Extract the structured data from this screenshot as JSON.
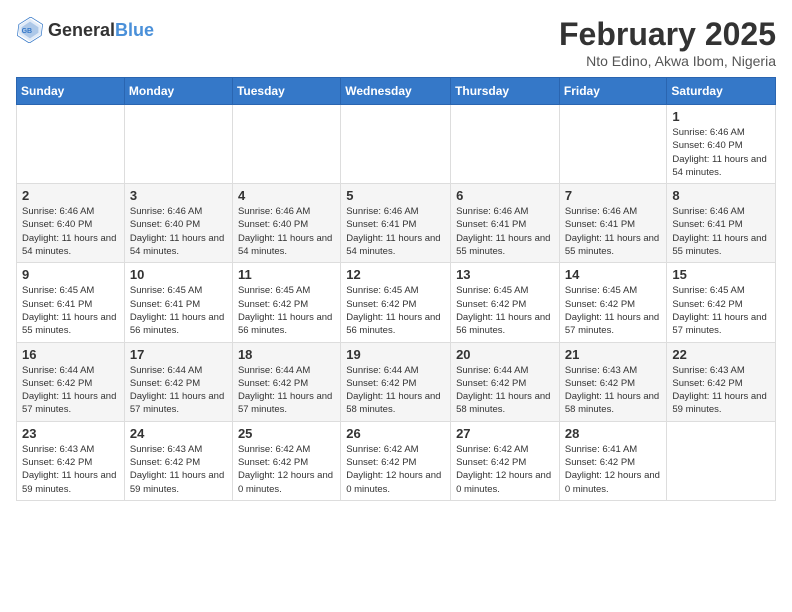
{
  "logo": {
    "text_general": "General",
    "text_blue": "Blue"
  },
  "title": "February 2025",
  "subtitle": "Nto Edino, Akwa Ibom, Nigeria",
  "days_of_week": [
    "Sunday",
    "Monday",
    "Tuesday",
    "Wednesday",
    "Thursday",
    "Friday",
    "Saturday"
  ],
  "weeks": [
    [
      {
        "day": "",
        "info": ""
      },
      {
        "day": "",
        "info": ""
      },
      {
        "day": "",
        "info": ""
      },
      {
        "day": "",
        "info": ""
      },
      {
        "day": "",
        "info": ""
      },
      {
        "day": "",
        "info": ""
      },
      {
        "day": "1",
        "info": "Sunrise: 6:46 AM\nSunset: 6:40 PM\nDaylight: 11 hours and 54 minutes."
      }
    ],
    [
      {
        "day": "2",
        "info": "Sunrise: 6:46 AM\nSunset: 6:40 PM\nDaylight: 11 hours and 54 minutes."
      },
      {
        "day": "3",
        "info": "Sunrise: 6:46 AM\nSunset: 6:40 PM\nDaylight: 11 hours and 54 minutes."
      },
      {
        "day": "4",
        "info": "Sunrise: 6:46 AM\nSunset: 6:40 PM\nDaylight: 11 hours and 54 minutes."
      },
      {
        "day": "5",
        "info": "Sunrise: 6:46 AM\nSunset: 6:41 PM\nDaylight: 11 hours and 54 minutes."
      },
      {
        "day": "6",
        "info": "Sunrise: 6:46 AM\nSunset: 6:41 PM\nDaylight: 11 hours and 55 minutes."
      },
      {
        "day": "7",
        "info": "Sunrise: 6:46 AM\nSunset: 6:41 PM\nDaylight: 11 hours and 55 minutes."
      },
      {
        "day": "8",
        "info": "Sunrise: 6:46 AM\nSunset: 6:41 PM\nDaylight: 11 hours and 55 minutes."
      }
    ],
    [
      {
        "day": "9",
        "info": "Sunrise: 6:45 AM\nSunset: 6:41 PM\nDaylight: 11 hours and 55 minutes."
      },
      {
        "day": "10",
        "info": "Sunrise: 6:45 AM\nSunset: 6:41 PM\nDaylight: 11 hours and 56 minutes."
      },
      {
        "day": "11",
        "info": "Sunrise: 6:45 AM\nSunset: 6:42 PM\nDaylight: 11 hours and 56 minutes."
      },
      {
        "day": "12",
        "info": "Sunrise: 6:45 AM\nSunset: 6:42 PM\nDaylight: 11 hours and 56 minutes."
      },
      {
        "day": "13",
        "info": "Sunrise: 6:45 AM\nSunset: 6:42 PM\nDaylight: 11 hours and 56 minutes."
      },
      {
        "day": "14",
        "info": "Sunrise: 6:45 AM\nSunset: 6:42 PM\nDaylight: 11 hours and 57 minutes."
      },
      {
        "day": "15",
        "info": "Sunrise: 6:45 AM\nSunset: 6:42 PM\nDaylight: 11 hours and 57 minutes."
      }
    ],
    [
      {
        "day": "16",
        "info": "Sunrise: 6:44 AM\nSunset: 6:42 PM\nDaylight: 11 hours and 57 minutes."
      },
      {
        "day": "17",
        "info": "Sunrise: 6:44 AM\nSunset: 6:42 PM\nDaylight: 11 hours and 57 minutes."
      },
      {
        "day": "18",
        "info": "Sunrise: 6:44 AM\nSunset: 6:42 PM\nDaylight: 11 hours and 57 minutes."
      },
      {
        "day": "19",
        "info": "Sunrise: 6:44 AM\nSunset: 6:42 PM\nDaylight: 11 hours and 58 minutes."
      },
      {
        "day": "20",
        "info": "Sunrise: 6:44 AM\nSunset: 6:42 PM\nDaylight: 11 hours and 58 minutes."
      },
      {
        "day": "21",
        "info": "Sunrise: 6:43 AM\nSunset: 6:42 PM\nDaylight: 11 hours and 58 minutes."
      },
      {
        "day": "22",
        "info": "Sunrise: 6:43 AM\nSunset: 6:42 PM\nDaylight: 11 hours and 59 minutes."
      }
    ],
    [
      {
        "day": "23",
        "info": "Sunrise: 6:43 AM\nSunset: 6:42 PM\nDaylight: 11 hours and 59 minutes."
      },
      {
        "day": "24",
        "info": "Sunrise: 6:43 AM\nSunset: 6:42 PM\nDaylight: 11 hours and 59 minutes."
      },
      {
        "day": "25",
        "info": "Sunrise: 6:42 AM\nSunset: 6:42 PM\nDaylight: 12 hours and 0 minutes."
      },
      {
        "day": "26",
        "info": "Sunrise: 6:42 AM\nSunset: 6:42 PM\nDaylight: 12 hours and 0 minutes."
      },
      {
        "day": "27",
        "info": "Sunrise: 6:42 AM\nSunset: 6:42 PM\nDaylight: 12 hours and 0 minutes."
      },
      {
        "day": "28",
        "info": "Sunrise: 6:41 AM\nSunset: 6:42 PM\nDaylight: 12 hours and 0 minutes."
      },
      {
        "day": "",
        "info": ""
      }
    ]
  ]
}
